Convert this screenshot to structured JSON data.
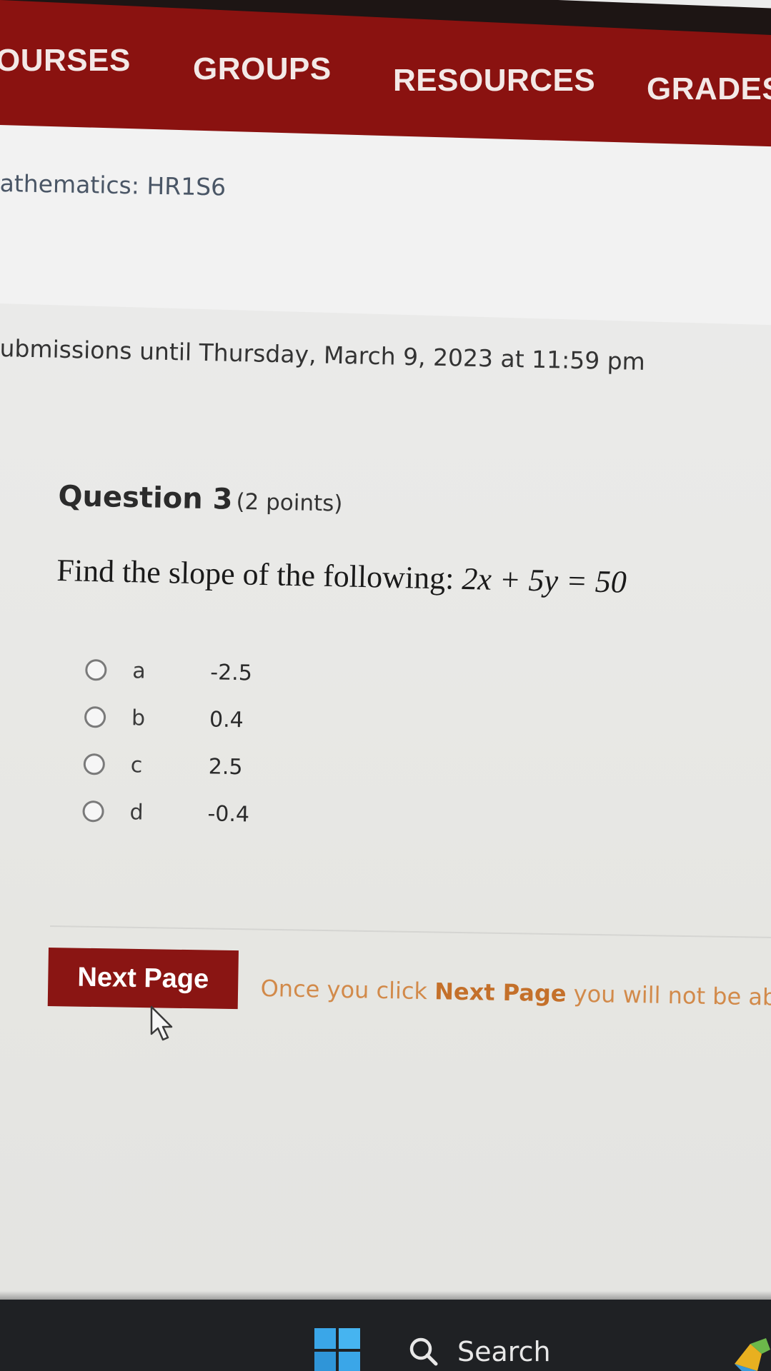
{
  "nav": {
    "items": [
      {
        "label": "OURSES"
      },
      {
        "label": "GROUPS"
      },
      {
        "label": "RESOURCES"
      },
      {
        "label": "GRADES"
      }
    ]
  },
  "course": {
    "title": "athematics: HR1S6",
    "submissions": "ubmissions until Thursday, March 9, 2023 at 11:59 pm"
  },
  "question": {
    "title": "Question 3",
    "points": "(2 points)",
    "prompt": "Find the slope of the following: ",
    "equation": "2x + 5y = 50",
    "options": [
      {
        "letter": "a",
        "value": "-2.5"
      },
      {
        "letter": "b",
        "value": "0.4"
      },
      {
        "letter": "c",
        "value": "2.5"
      },
      {
        "letter": "d",
        "value": "-0.4"
      }
    ]
  },
  "footer": {
    "next_label": "Next Page",
    "note_prefix": "Once you click ",
    "note_strong": "Next Page",
    "note_suffix": " you will not be ab"
  },
  "taskbar": {
    "search_label": "Search"
  },
  "colors": {
    "nav_bg": "#8a1210",
    "button_bg": "#8a1513",
    "note_text": "#d28a4a"
  }
}
